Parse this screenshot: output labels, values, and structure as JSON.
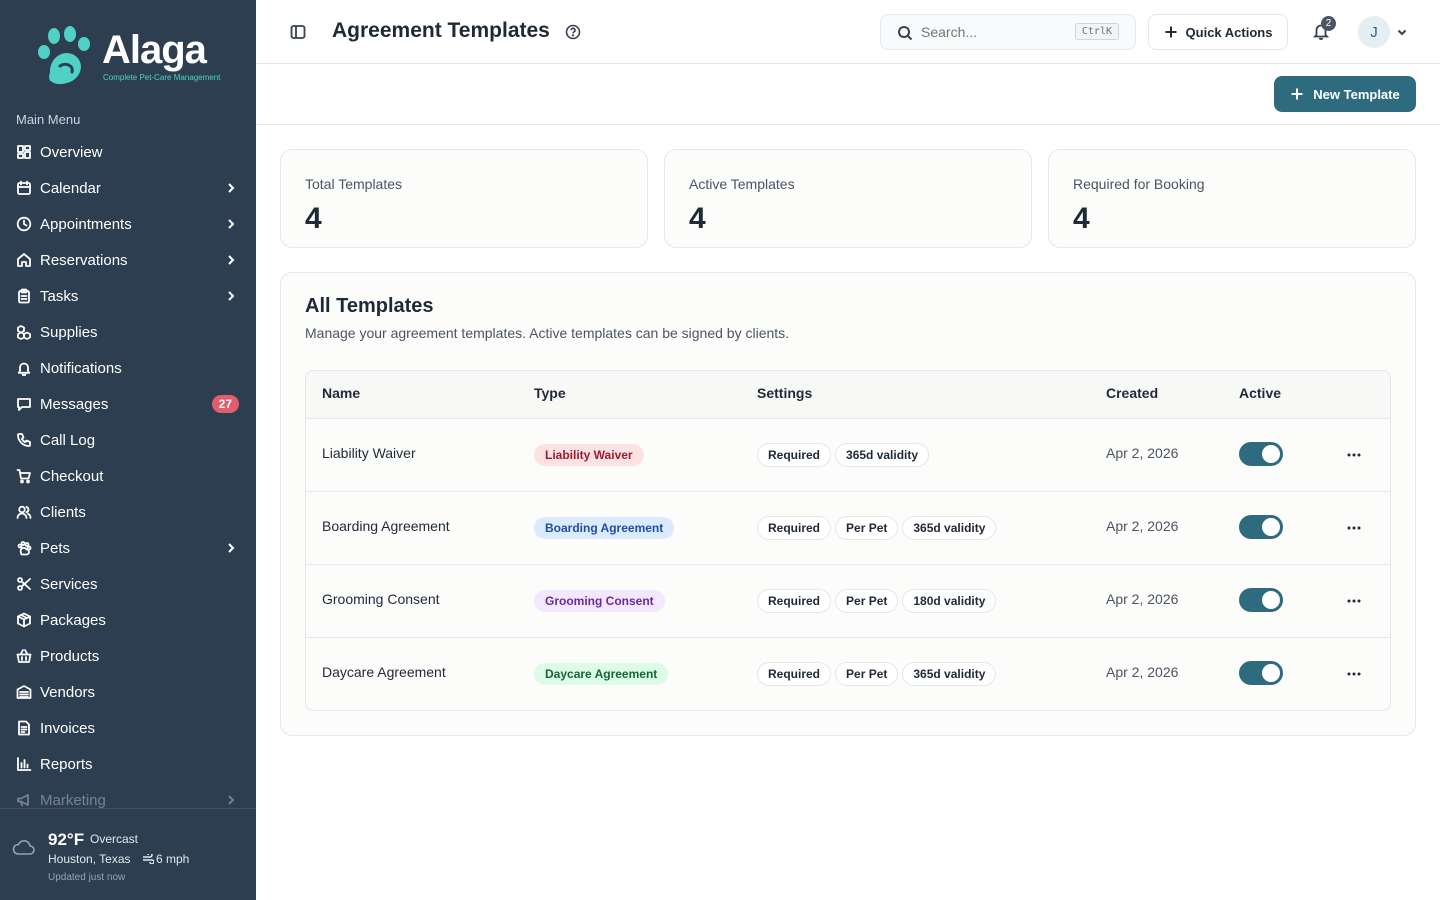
{
  "brand": {
    "name": "Alaga",
    "tagline": "Complete Pet-Care Management",
    "logo_color": "#4fd1c5"
  },
  "sidebar": {
    "section_title": "Main Menu",
    "items": [
      {
        "label": "Overview",
        "icon": "grid-icon",
        "chevron": false
      },
      {
        "label": "Calendar",
        "icon": "calendar-icon",
        "chevron": true
      },
      {
        "label": "Appointments",
        "icon": "clock-icon",
        "chevron": true
      },
      {
        "label": "Reservations",
        "icon": "home-icon",
        "chevron": true
      },
      {
        "label": "Tasks",
        "icon": "clipboard-icon",
        "chevron": true
      },
      {
        "label": "Supplies",
        "icon": "boxes-icon",
        "chevron": false
      },
      {
        "label": "Notifications",
        "icon": "bell-icon",
        "chevron": false
      },
      {
        "label": "Messages",
        "icon": "message-icon",
        "chevron": false,
        "badge": "27"
      },
      {
        "label": "Call Log",
        "icon": "phone-icon",
        "chevron": false
      },
      {
        "label": "Checkout",
        "icon": "cart-icon",
        "chevron": false
      },
      {
        "label": "Clients",
        "icon": "users-icon",
        "chevron": false
      },
      {
        "label": "Pets",
        "icon": "paw-icon",
        "chevron": true
      },
      {
        "label": "Services",
        "icon": "scissors-icon",
        "chevron": false
      },
      {
        "label": "Packages",
        "icon": "package-icon",
        "chevron": false
      },
      {
        "label": "Products",
        "icon": "basket-icon",
        "chevron": false
      },
      {
        "label": "Vendors",
        "icon": "warehouse-icon",
        "chevron": false
      },
      {
        "label": "Invoices",
        "icon": "invoice-icon",
        "chevron": false
      },
      {
        "label": "Reports",
        "icon": "bar-chart-icon",
        "chevron": false
      },
      {
        "label": "Marketing",
        "icon": "megaphone-icon",
        "chevron": true
      }
    ],
    "weather": {
      "temp": "92°F",
      "condition": "Overcast",
      "location": "Houston, Texas",
      "wind": "6 mph",
      "updated": "Updated just now"
    }
  },
  "header": {
    "title": "Agreement Templates",
    "search_placeholder": "Search...",
    "search_shortcut": "CtrlK",
    "quick_actions": "Quick Actions",
    "notification_count": "2",
    "avatar_initial": "J"
  },
  "toolbar": {
    "new_template": "New Template"
  },
  "stats": [
    {
      "label": "Total Templates",
      "value": "4"
    },
    {
      "label": "Active Templates",
      "value": "4"
    },
    {
      "label": "Required for Booking",
      "value": "4"
    }
  ],
  "templates": {
    "title": "All Templates",
    "subtitle": "Manage your agreement templates. Active templates can be signed by clients.",
    "columns": [
      "Name",
      "Type",
      "Settings",
      "Created",
      "Active"
    ],
    "rows": [
      {
        "name": "Liability Waiver",
        "type": "Liability Waiver",
        "type_bg": "#fde2e4",
        "type_fg": "#9b1c31",
        "settings": [
          "Required",
          "365d validity"
        ],
        "created": "Apr 2, 2026",
        "active": true
      },
      {
        "name": "Boarding Agreement",
        "type": "Boarding Agreement",
        "type_bg": "#dbeafe",
        "type_fg": "#1e4fa0",
        "settings": [
          "Required",
          "Per Pet",
          "365d validity"
        ],
        "created": "Apr 2, 2026",
        "active": true
      },
      {
        "name": "Grooming Consent",
        "type": "Grooming Consent",
        "type_bg": "#f3e8ff",
        "type_fg": "#6b2a96",
        "settings": [
          "Required",
          "Per Pet",
          "180d validity"
        ],
        "created": "Apr 2, 2026",
        "active": true
      },
      {
        "name": "Daycare Agreement",
        "type": "Daycare Agreement",
        "type_bg": "#dcfce7",
        "type_fg": "#166534",
        "settings": [
          "Required",
          "Per Pet",
          "365d validity"
        ],
        "created": "Apr 2, 2026",
        "active": true
      }
    ]
  },
  "colors": {
    "sidebar_bg": "#2c3e50",
    "accent": "#2f6b7f",
    "badge_red": "#e35d6a"
  }
}
